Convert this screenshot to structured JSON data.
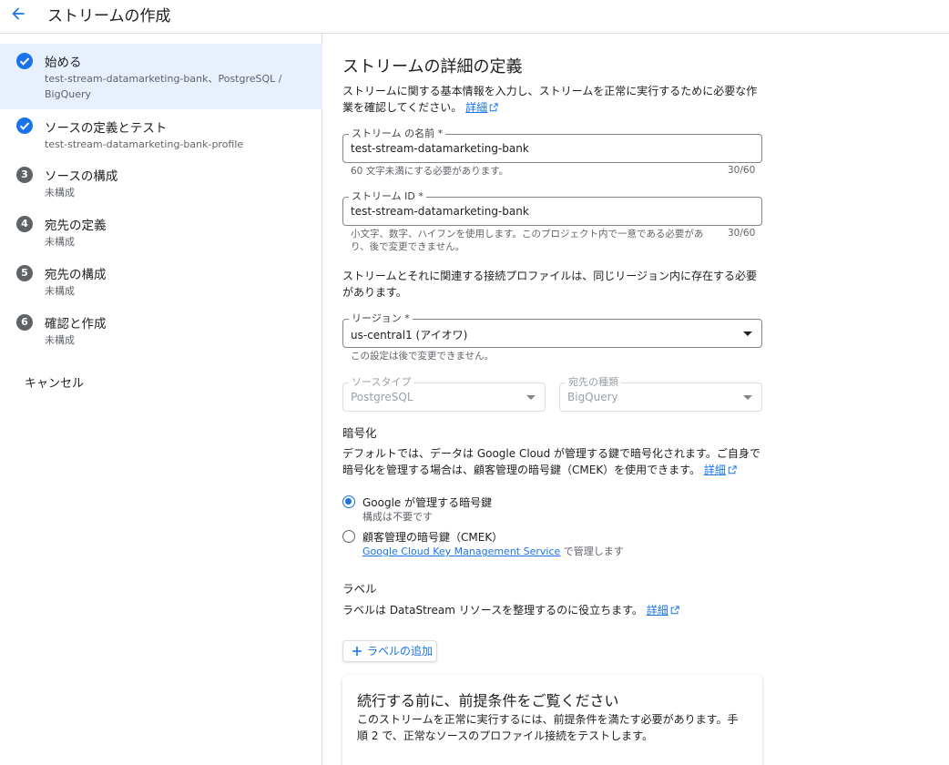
{
  "header": {
    "title": "ストリームの作成"
  },
  "sidebar": {
    "steps": [
      {
        "label": "始める",
        "sub": "test-stream-datamarketing-bank、PostgreSQL / BigQuery",
        "status": "done"
      },
      {
        "label": "ソースの定義とテスト",
        "sub": "test-stream-datamarketing-bank-profile",
        "status": "done"
      },
      {
        "label": "ソースの構成",
        "sub": "未構成",
        "number": "3"
      },
      {
        "label": "宛先の定義",
        "sub": "未構成",
        "number": "4"
      },
      {
        "label": "宛先の構成",
        "sub": "未構成",
        "number": "5"
      },
      {
        "label": "確認と作成",
        "sub": "未構成",
        "number": "6"
      }
    ],
    "cancel_label": "キャンセル"
  },
  "main": {
    "title": "ストリームの詳細の定義",
    "intro": "ストリームに関する基本情報を入力し、ストリームを正常に実行するために必要な作業を確認してください。",
    "details_link": "詳細",
    "stream_name": {
      "label": "ストリーム の名前 *",
      "value": "test-stream-datamarketing-bank",
      "hint": "60 文字未満にする必要があります。",
      "counter": "30/60"
    },
    "stream_id": {
      "label": "ストリーム ID *",
      "value": "test-stream-datamarketing-bank",
      "hint": "小文字、数字、ハイフンを使用します。このプロジェクト内で一意である必要があり、後で変更できません。",
      "counter": "30/60"
    },
    "region_note": "ストリームとそれに関連する接続プロファイルは、同じリージョン内に存在する必要があります。",
    "region": {
      "label": "リージョン *",
      "value": "us-central1 (アイオワ)",
      "hint": "この設定は後で変更できません。"
    },
    "source_type": {
      "label": "ソースタイプ",
      "value": "PostgreSQL"
    },
    "dest_type": {
      "label": "宛先の種類",
      "value": "BigQuery"
    },
    "encryption": {
      "heading": "暗号化",
      "desc": "デフォルトでは、データは Google Cloud が管理する鍵で暗号化されます。ご自身で暗号化を管理する場合は、顧客管理の暗号鍵（CMEK）を使用できます。",
      "link": "詳細",
      "opt1_label": "Google が管理する暗号鍵",
      "opt1_sub": "構成は不要です",
      "opt2_label": "顧客管理の暗号鍵（CMEK）",
      "opt2_link": "Google Cloud Key Management Service",
      "opt2_suffix": " で管理します"
    },
    "labels": {
      "heading": "ラベル",
      "desc": "ラベルは DataStream リソースを整理するのに役立ちます。",
      "link": "詳細",
      "add_button": "ラベルの追加"
    },
    "prereq": {
      "title": "続行する前に、前提条件をご覧ください",
      "body": "このストリームを正常に実行するには、前提条件を満たす必要があります。手順 2 で、正常なソースのプロファイル接続をテストします。"
    }
  },
  "colors": {
    "accent": "#1a73e8",
    "active_bg": "#e8f0fe",
    "step_grey": "#5f6368"
  }
}
